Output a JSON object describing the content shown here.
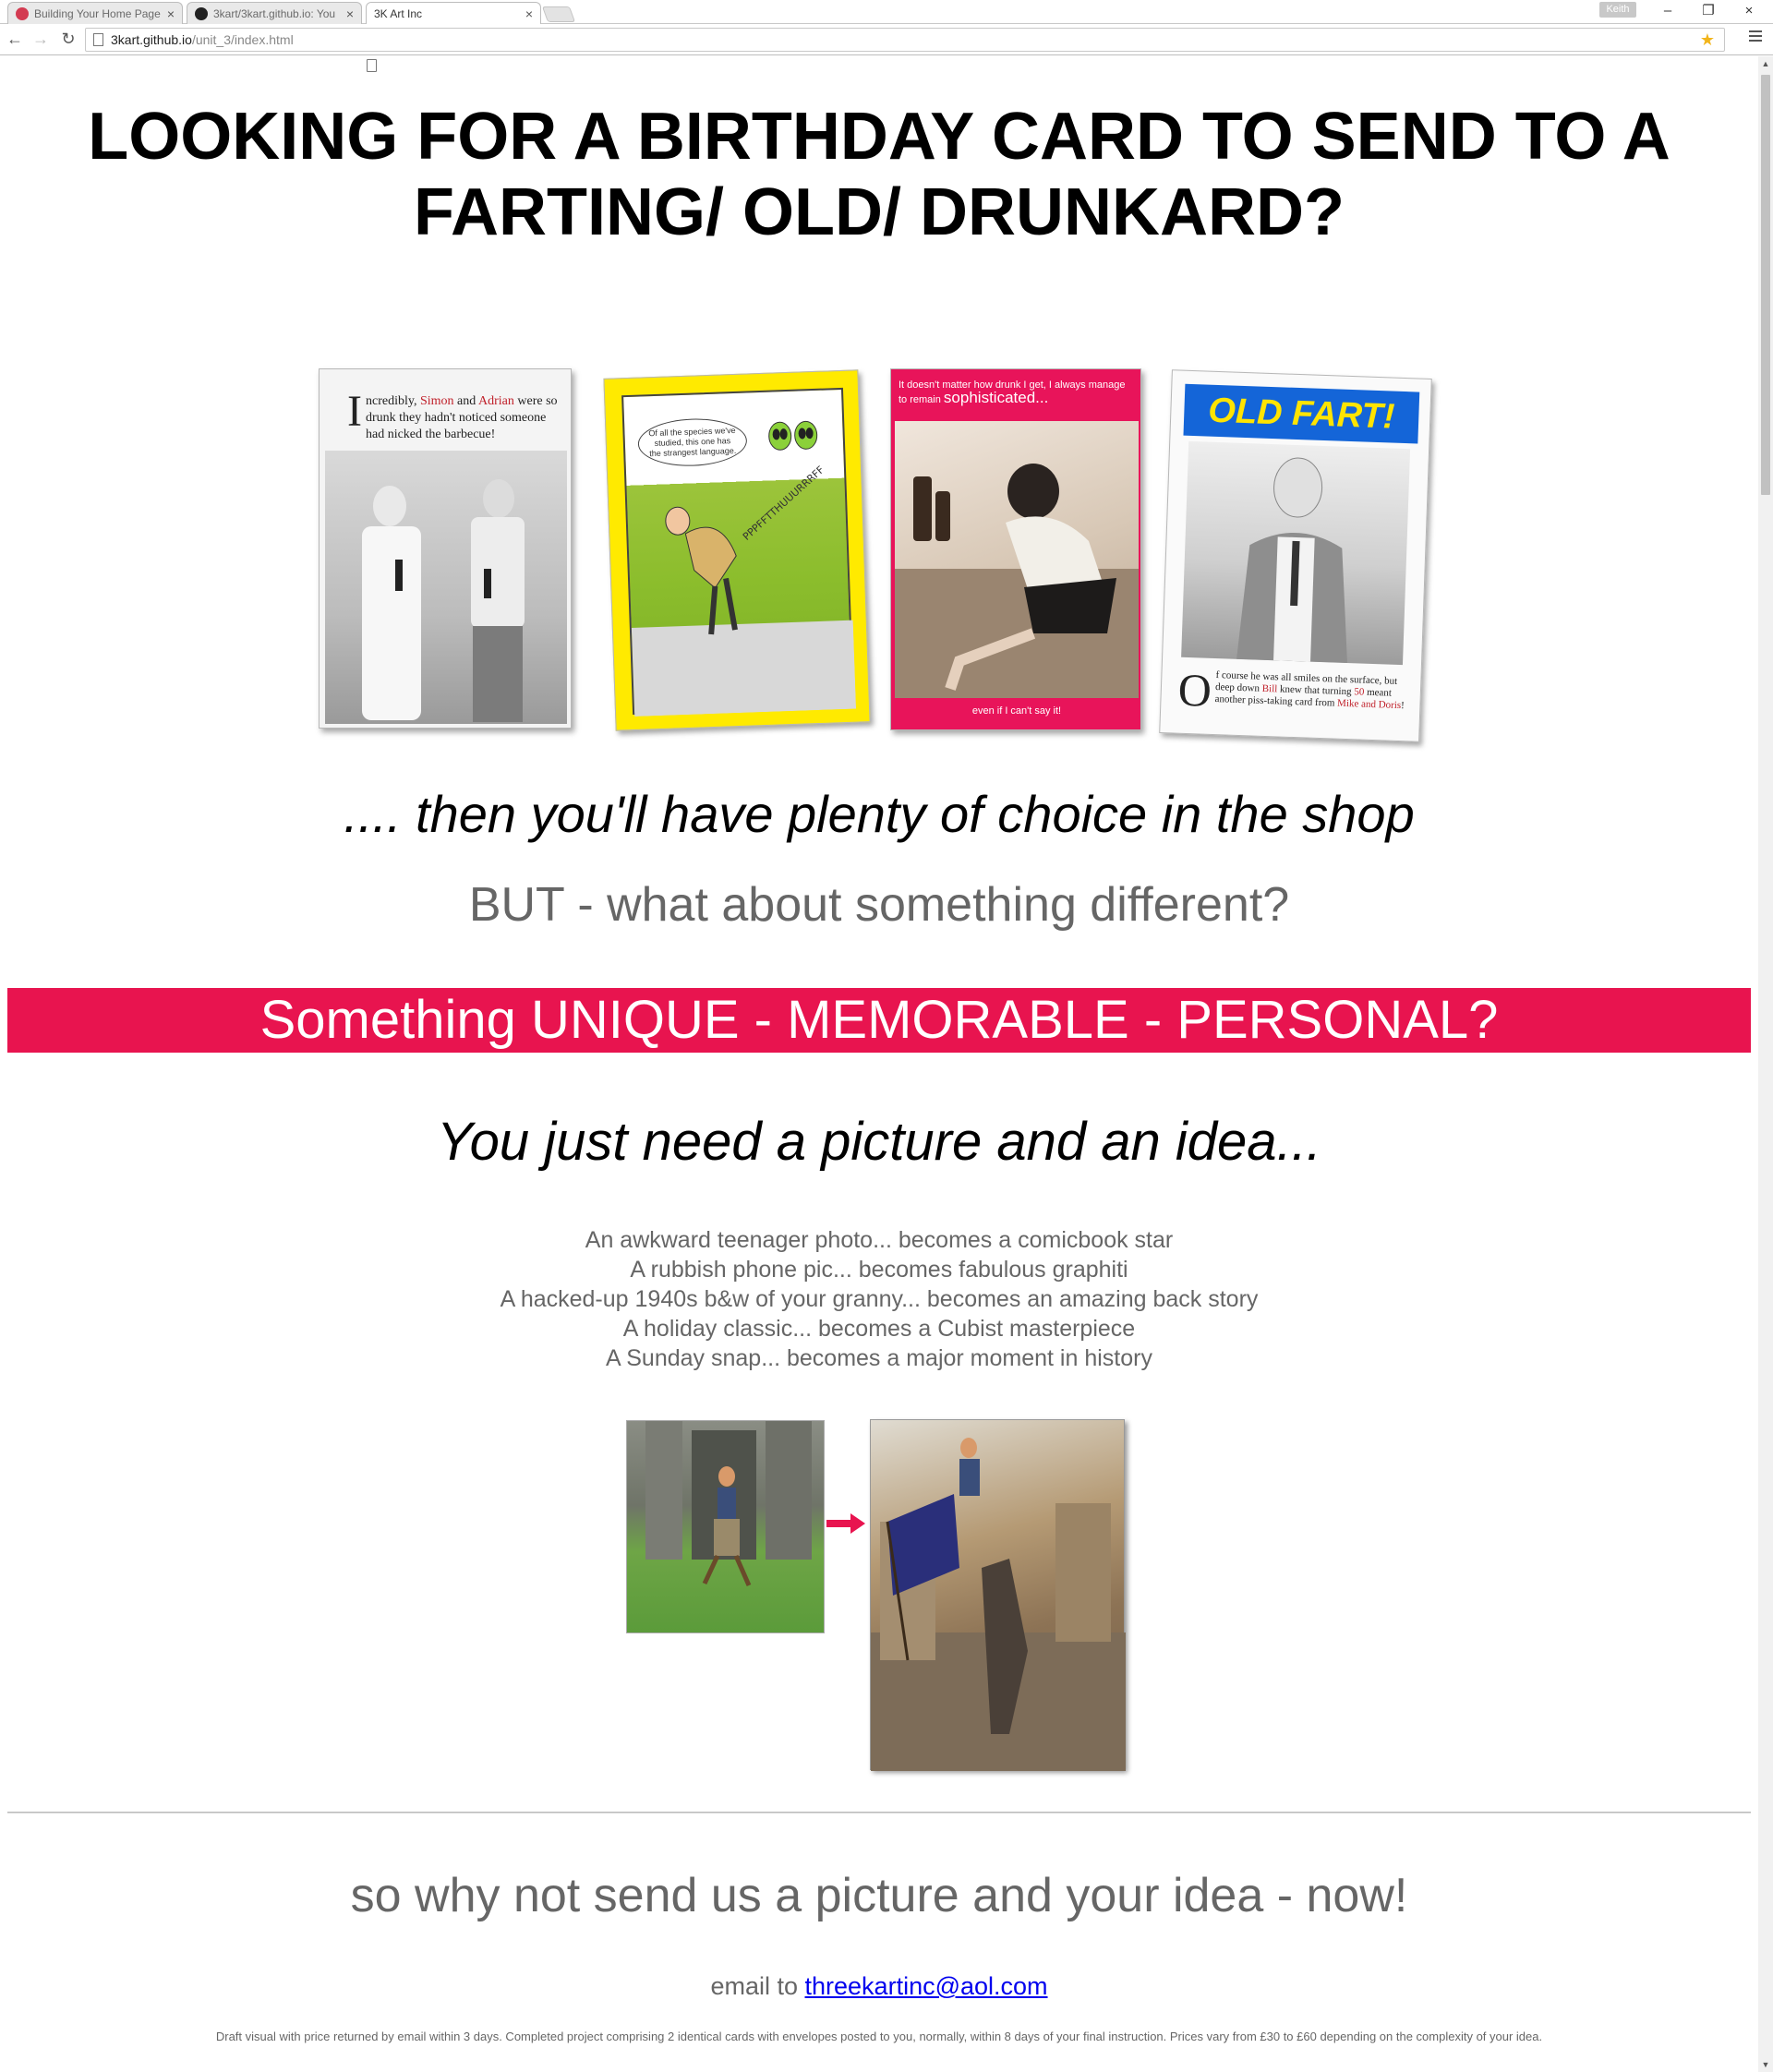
{
  "browser": {
    "tabs": [
      {
        "title": "Building Your Home Page",
        "close": "×"
      },
      {
        "title": "3kart/3kart.github.io: You",
        "close": "×"
      },
      {
        "title": "3K Art Inc",
        "close": "×"
      }
    ],
    "user": "Keith",
    "url_host": "3kart.github.io",
    "url_path": "/unit_3/index.html",
    "window": {
      "minimize": "–",
      "restore": "❐",
      "close": "×"
    },
    "nav": {
      "back": "←",
      "forward": "→",
      "reload": "↻"
    }
  },
  "page": {
    "headline": "LOOKING FOR A BIRTHDAY CARD TO SEND TO A FARTING/ OLD/ DRUNKARD?",
    "cards": {
      "card1": {
        "dropcap": "I",
        "text_a": "ncredibly, ",
        "name1": "Simon",
        "text_b": " and ",
        "name2": "Adrian",
        "text_c": " were so drunk they hadn't noticed someone had nicked the barbecue!"
      },
      "card2": {
        "bubble": "Of all the species we've studied, this one has the strangest language.",
        "sound": "PPPFFTTHUUURRRFF"
      },
      "card3": {
        "top": "It doesn't matter how drunk I get, I always manage to remain ",
        "top_big": "sophisticated...",
        "bottom": "even if I can't say it!"
      },
      "card4": {
        "banner": "OLD FART!",
        "dropcap": "O",
        "text_a": "f course he was all smiles on the surface, but deep down ",
        "name1": "Bill",
        "text_b": " knew that turning ",
        "age": "50",
        "text_c": " meant another piss-taking card from ",
        "name2": "Mike and Doris",
        "text_d": "!"
      }
    },
    "choice": ".... then you'll have plenty of choice in the shop",
    "different": "BUT - what about something different?",
    "unique": "Something UNIQUE - MEMORABLE - PERSONAL?",
    "need": "You just need a picture and an idea...",
    "examples": [
      "An awkward teenager photo... becomes a comicbook star",
      "A rubbish phone pic... becomes fabulous graphiti",
      "A hacked-up 1940s b&w of your granny... becomes an amazing back story",
      "A holiday classic... becomes a Cubist masterpiece",
      "A Sunday snap... becomes a major moment in history"
    ],
    "why": "so why not send us a picture and your idea - now!",
    "email_prefix": "email to ",
    "email": "threekartinc@aol.com",
    "draft": "Draft visual with price returned by email within 3 days. Completed project comprising 2 identical cards with envelopes posted to you, normally, within 8 days of your final instruction. Prices vary from £30 to £60 depending on the complexity of your idea."
  },
  "colors": {
    "banner_pink": "#e8144f",
    "link_blue": "#0000ee",
    "grey_text": "#666666"
  }
}
